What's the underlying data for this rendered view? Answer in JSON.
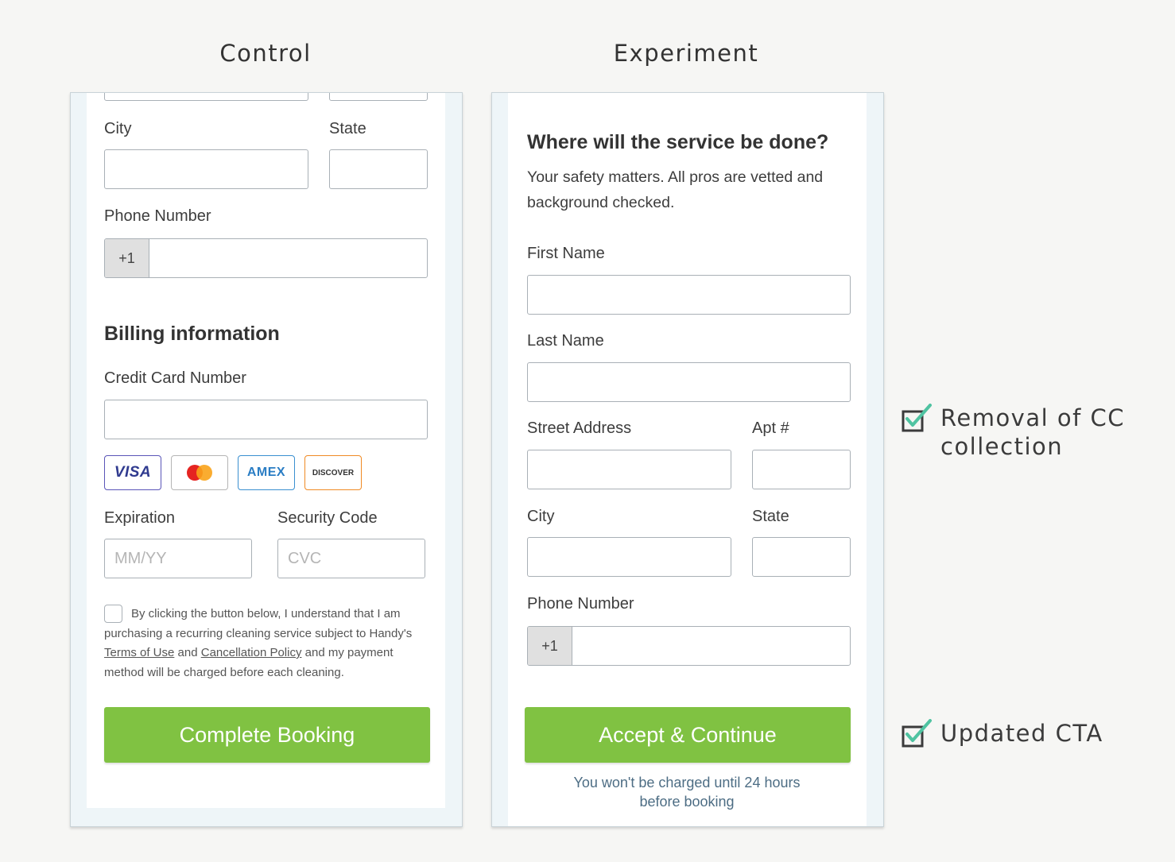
{
  "columns": {
    "control_title": "Control",
    "experiment_title": "Experiment"
  },
  "control": {
    "city_label": "City",
    "state_label": "State",
    "phone_label": "Phone Number",
    "phone_prefix": "+1",
    "billing_heading": "Billing information",
    "cc_label": "Credit Card Number",
    "cards": [
      "VISA",
      "mastercard",
      "AMEX",
      "DISCOVER"
    ],
    "expiration_label": "Expiration",
    "expiration_placeholder": "MM/YY",
    "security_label": "Security Code",
    "security_placeholder": "CVC",
    "consent_prefix": "By clicking the button below, I understand that I am purchasing a recurring cleaning service subject to Handy's ",
    "terms_link": "Terms of Use",
    "consent_and": " and ",
    "cancellation_link": "Cancellation Policy",
    "consent_suffix": " and my payment method will be charged before each cleaning.",
    "cta_label": "Complete Booking",
    "cta_color": "#80c242"
  },
  "experiment": {
    "heading": "Where will the service be done?",
    "subtext": "Your safety matters. All pros are vetted and background checked.",
    "first_name_label": "First Name",
    "last_name_label": "Last Name",
    "street_label": "Street Address",
    "apt_label": "Apt #",
    "city_label": "City",
    "state_label": "State",
    "phone_label": "Phone Number",
    "phone_prefix": "+1",
    "cta_label": "Accept & Continue",
    "note": "You won't be charged until 24 hours before booking"
  },
  "annotations": [
    {
      "icon": "checkbox-check-icon",
      "text": "Removal of CC collection"
    },
    {
      "icon": "checkbox-check-icon",
      "text": "Updated CTA"
    }
  ],
  "colors": {
    "check_accent": "#4fc3a1",
    "background": "#f6f6f4"
  }
}
